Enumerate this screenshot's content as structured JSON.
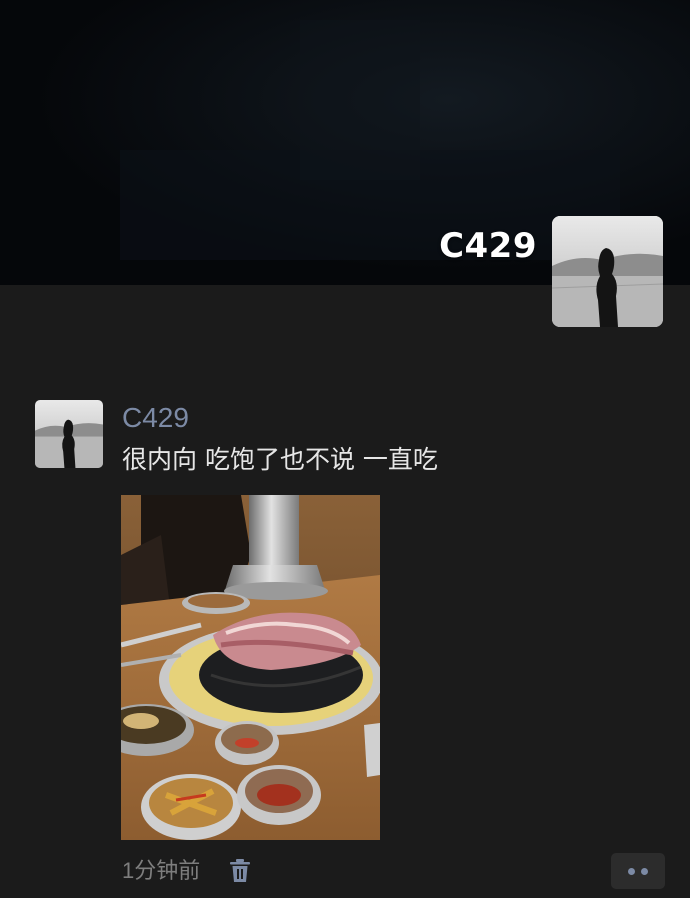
{
  "cover": {
    "owner_name": "C429"
  },
  "post": {
    "author": "C429",
    "text": "很内向 吃饱了也不说 一直吃",
    "time": "1分钟前"
  },
  "icons": {
    "delete": "trash-icon",
    "more": "more-dots-icon"
  },
  "colors": {
    "background": "#1b1b1b",
    "author_name": "#7c8aa5",
    "time_text": "#7e7e7e",
    "more_button_bg": "#2c2c2c"
  }
}
